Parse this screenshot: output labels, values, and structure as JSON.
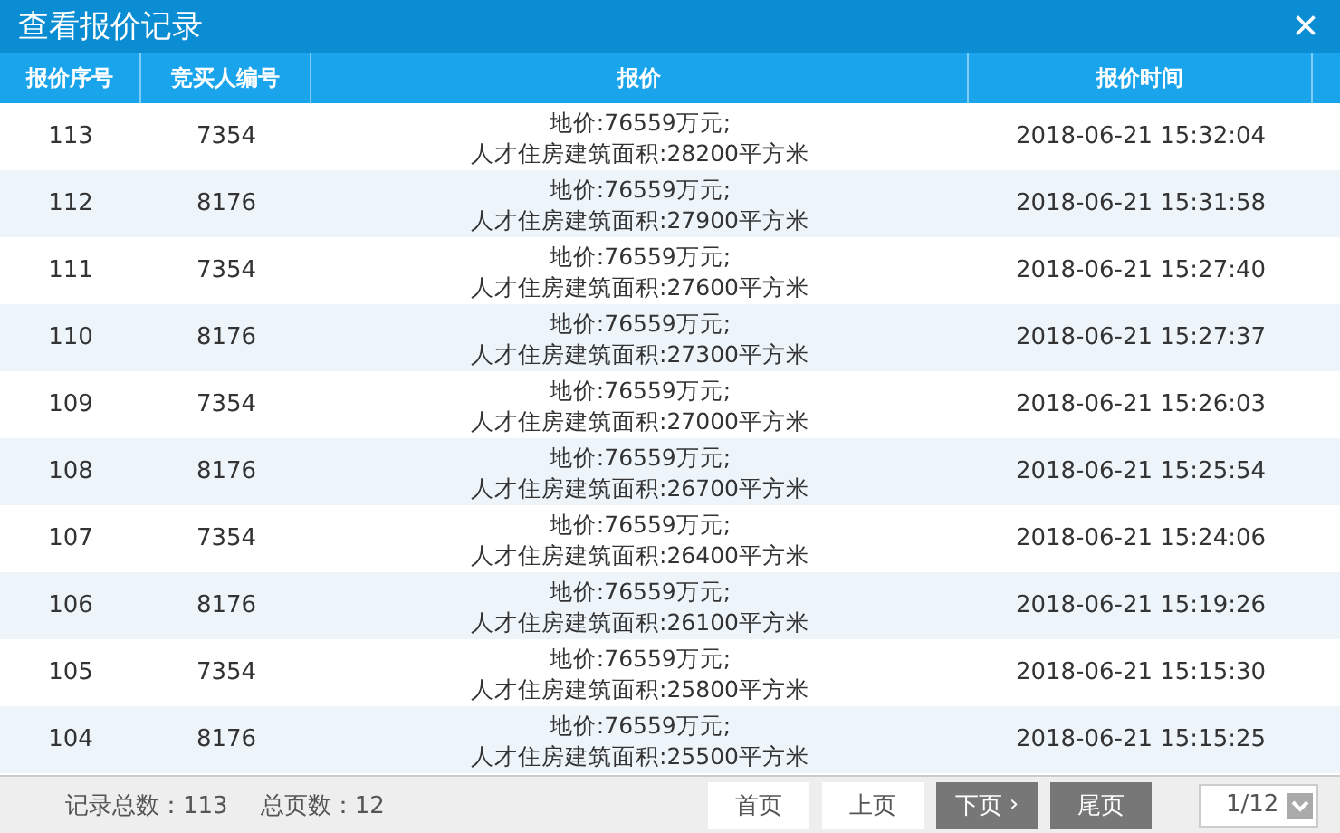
{
  "window": {
    "title": "查看报价记录",
    "close": "×"
  },
  "table": {
    "columns": [
      "报价序号",
      "竞买人编号",
      "报价",
      "报价时间"
    ],
    "rows": [
      {
        "number": "113",
        "bidder": "7354",
        "price": [
          "地价:76559万元;",
          "人才住房建筑面积:28200平方米"
        ],
        "time": "2018-06-21 15:32:04"
      },
      {
        "number": "112",
        "bidder": "8176",
        "price": [
          "地价:76559万元;",
          "人才住房建筑面积:27900平方米"
        ],
        "time": "2018-06-21 15:31:58"
      },
      {
        "number": "111",
        "bidder": "7354",
        "price": [
          "地价:76559万元;",
          "人才住房建筑面积:27600平方米"
        ],
        "time": "2018-06-21 15:27:40"
      },
      {
        "number": "110",
        "bidder": "8176",
        "price": [
          "地价:76559万元;",
          "人才住房建筑面积:27300平方米"
        ],
        "time": "2018-06-21 15:27:37"
      },
      {
        "number": "109",
        "bidder": "7354",
        "price": [
          "地价:76559万元;",
          "人才住房建筑面积:27000平方米"
        ],
        "time": "2018-06-21 15:26:03"
      },
      {
        "number": "108",
        "bidder": "8176",
        "price": [
          "地价:76559万元;",
          "人才住房建筑面积:26700平方米"
        ],
        "time": "2018-06-21 15:25:54"
      },
      {
        "number": "107",
        "bidder": "7354",
        "price": [
          "地价:76559万元;",
          "人才住房建筑面积:26400平方米"
        ],
        "time": "2018-06-21 15:24:06"
      },
      {
        "number": "106",
        "bidder": "8176",
        "price": [
          "地价:76559万元;",
          "人才住房建筑面积:26100平方米"
        ],
        "time": "2018-06-21 15:19:26"
      },
      {
        "number": "105",
        "bidder": "7354",
        "price": [
          "地价:76559万元;",
          "人才住房建筑面积:25800平方米"
        ],
        "time": "2018-06-21 15:15:30"
      },
      {
        "number": "104",
        "bidder": "8176",
        "price": [
          "地价:76559万元;",
          "人才住房建筑面积:25500平方米"
        ],
        "time": "2018-06-21 15:15:25"
      }
    ]
  },
  "footer": {
    "total_records": "记录总数：113",
    "total_pages": "总页数：12",
    "buttons": [
      {
        "label": "首页",
        "active": false
      },
      {
        "label": "上页",
        "active": false
      },
      {
        "label": "下页",
        "active": true,
        "arrow": "›"
      },
      {
        "label": "尾页",
        "active": true
      }
    ],
    "page_select": "1/12"
  }
}
